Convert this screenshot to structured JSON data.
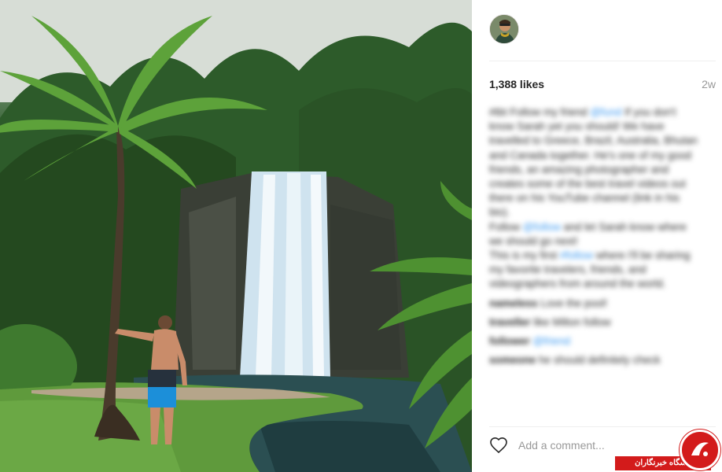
{
  "post": {
    "likes": "1,388 likes",
    "age": "2w",
    "caption": {
      "text1": "#tbt Follow my friend",
      "link1": "@fund",
      "text2": "If you don't know Sarah yet you should! We have travelled to Greece, Brazil, Australia, Bhutan and Canada together. He's one of my good friends, an amazing photographer and creates some of the best travel videos out there on his YouTube channel (link in his bio).",
      "text3": "Follow",
      "link2": "@follow",
      "text4": "and let Sarah know where we should go next!",
      "text5": "This is my first",
      "link3": "#follow",
      "text6": "where I'll be sharing my favorite travelers, friends, and videographers from around the world."
    },
    "comments": [
      {
        "user": "nameless",
        "text": "Love the pool!"
      },
      {
        "user": "traveller",
        "text": "like Milton follow"
      },
      {
        "user": "follower",
        "text": "@friend"
      },
      {
        "user": "someone",
        "text": "he should definitely check"
      }
    ]
  },
  "add_comment": {
    "placeholder": "Add a comment..."
  },
  "watermark": {
    "text": "باشگاه خبرنگاران"
  },
  "icons": {
    "heart": "heart-outline-icon",
    "avatar": "user-avatar"
  }
}
